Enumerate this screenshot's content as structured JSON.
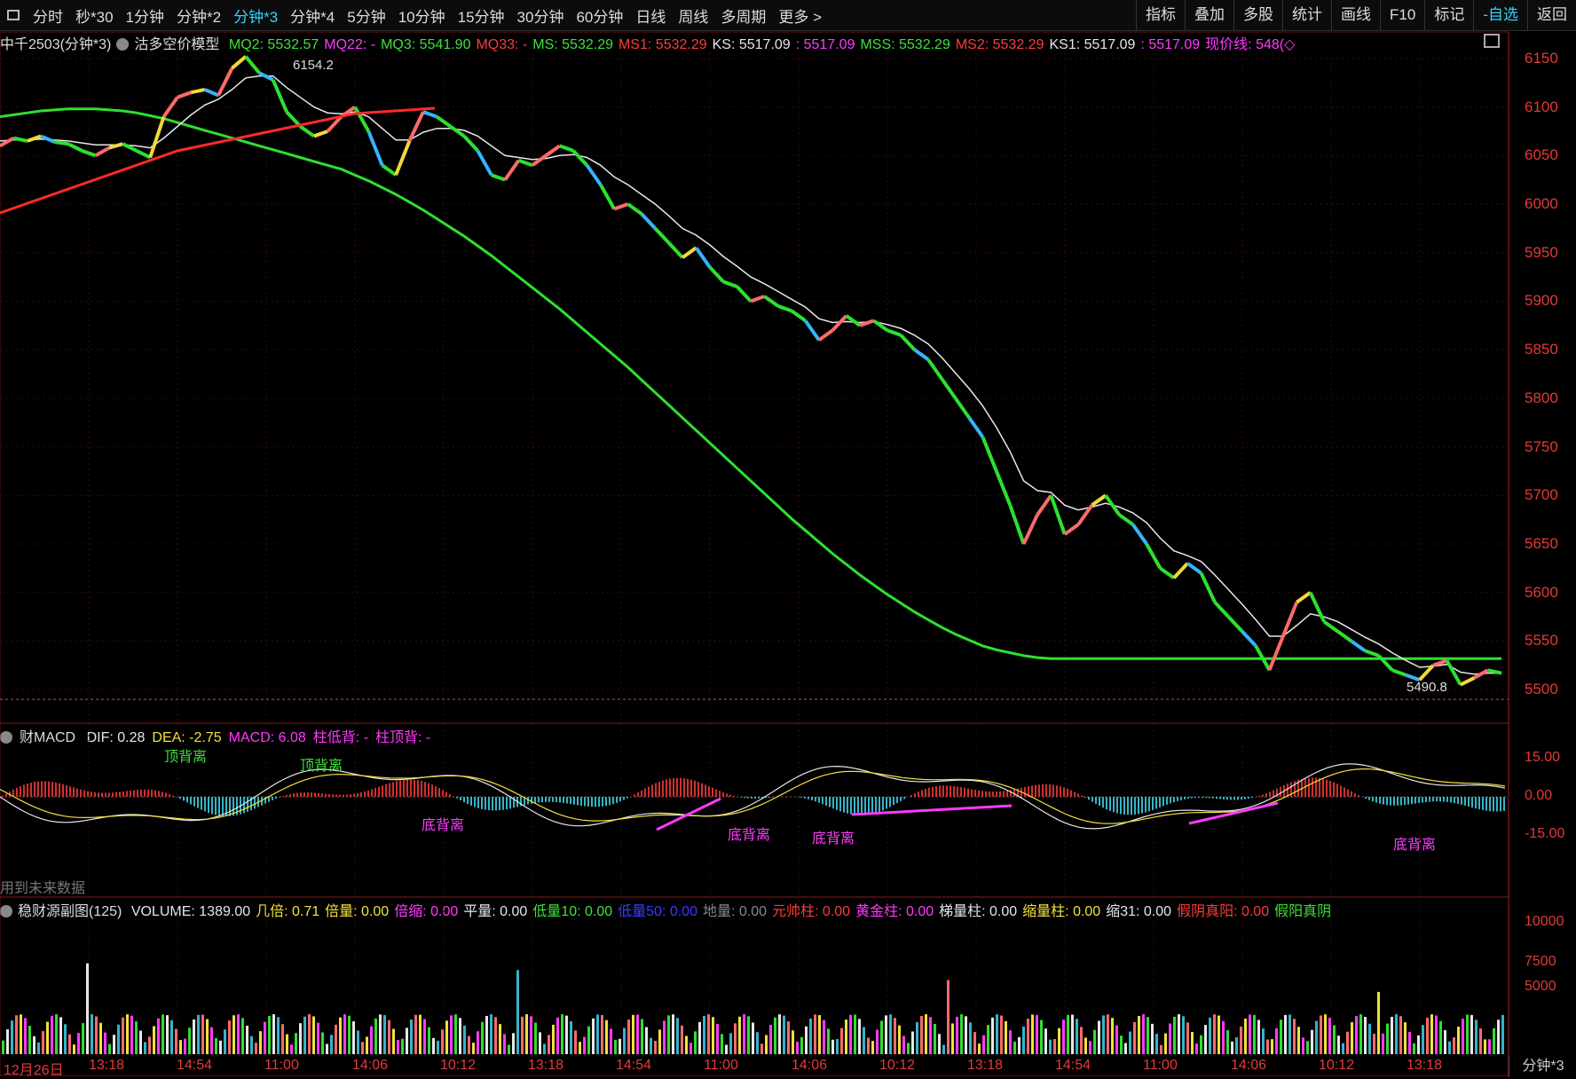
{
  "toolbar": {
    "periods": [
      "分时",
      "秒*30",
      "1分钟",
      "分钟*2",
      "分钟*3",
      "分钟*4",
      "5分钟",
      "10分钟",
      "15分钟",
      "30分钟",
      "60分钟",
      "日线",
      "周线",
      "多周期",
      "更多 >"
    ],
    "active_period": "分钟*3",
    "right_buttons": [
      "指标",
      "叠加",
      "多股",
      "统计",
      "画线",
      "F10",
      "标记",
      "-自选",
      "返回"
    ],
    "selected_right": "-自选"
  },
  "main_indicator": {
    "symbol": "中千2503(分钟*3)",
    "model": "沽多空价模型",
    "items": [
      {
        "label": "MQ2: 5532.57",
        "color": "#3ee03e"
      },
      {
        "label": "MQ22: -",
        "color": "#ff3aff"
      },
      {
        "label": "MQ3: 5541.90",
        "color": "#3ee03e"
      },
      {
        "label": "MQ33: -",
        "color": "#ff3b3b"
      },
      {
        "label": "MS: 5532.29",
        "color": "#3ee03e"
      },
      {
        "label": "MS1: 5532.29",
        "color": "#ff3b3b"
      },
      {
        "label": "KS: 5517.09",
        "color": "#e6e6e6"
      },
      {
        "label": ": 5517.09",
        "color": "#ff3aff"
      },
      {
        "label": "MSS: 5532.29",
        "color": "#3ee03e"
      },
      {
        "label": "MS2: 5532.29",
        "color": "#ff3b3b"
      },
      {
        "label": "KS1: 5517.09",
        "color": "#e6e6e6"
      },
      {
        "label": ": 5517.09",
        "color": "#ff3aff"
      },
      {
        "label": "现价线: 548(◇",
        "color": "#ff3aff"
      }
    ],
    "price_axis": [
      "6150",
      "6100",
      "6050",
      "6000",
      "5950",
      "5900",
      "5850",
      "5800",
      "5750",
      "5700",
      "5650",
      "5600",
      "5550",
      "5500"
    ],
    "high_label": "6154.2",
    "low_label": "5490.8"
  },
  "macd_panel": {
    "title": "财MACD",
    "items": [
      {
        "label": "DIF: 0.28",
        "color": "#e6e6e6"
      },
      {
        "label": "DEA: -2.75",
        "color": "#f2e23a"
      },
      {
        "label": "MACD: 6.08",
        "color": "#ff3aff"
      },
      {
        "label": "柱低背: -",
        "color": "#ff3aff"
      },
      {
        "label": "柱顶背: -",
        "color": "#ff3aff"
      }
    ],
    "axis": [
      "15.00",
      "0.00",
      "-15.00"
    ],
    "annotations": [
      "顶背离",
      "顶背离",
      "底背离",
      "底背离",
      "底背离",
      "底背离"
    ],
    "future_note": "用到未来数据"
  },
  "volume_panel": {
    "title": "稳财源副图(125)",
    "items": [
      {
        "label": "VOLUME: 1389.00",
        "color": "#e6e6e6"
      },
      {
        "label": "几倍: 0.71",
        "color": "#f2e23a"
      },
      {
        "label": "倍量: 0.00",
        "color": "#f2e23a"
      },
      {
        "label": "倍缩: 0.00",
        "color": "#ff3aff"
      },
      {
        "label": "平量: 0.00",
        "color": "#e6e6e6"
      },
      {
        "label": "低量10: 0.00",
        "color": "#3ee03e"
      },
      {
        "label": "低量50: 0.00",
        "color": "#3a3aff"
      },
      {
        "label": "地量: 0.00",
        "color": "#888888"
      },
      {
        "label": "元帅柱: 0.00",
        "color": "#ff3b3b"
      },
      {
        "label": "黄金柱: 0.00",
        "color": "#ff3aff"
      },
      {
        "label": "梯量柱: 0.00",
        "color": "#e6e6e6"
      },
      {
        "label": "缩量柱: 0.00",
        "color": "#f2e23a"
      },
      {
        "label": "缩31: 0.00",
        "color": "#e6e6e6"
      },
      {
        "label": "假阴真阳: 0.00",
        "color": "#ff3b3b"
      },
      {
        "label": "假阳真阴",
        "color": "#3ee03e"
      }
    ],
    "axis": [
      "10000",
      "7500",
      "5000"
    ]
  },
  "time_axis": [
    "12月26日",
    "13:18",
    "14:54",
    "11:00",
    "14:06",
    "10:12",
    "13:18",
    "14:54",
    "11:00",
    "14:06",
    "10:12",
    "13:18",
    "14:54",
    "11:00",
    "14:06",
    "10:12",
    "13:18"
  ],
  "timeframe_label": "分钟*3",
  "chart_data": {
    "type": "line",
    "title": "中千2503(分钟*3)",
    "ylim": [
      5470,
      6170
    ],
    "price": [
      6060,
      6068,
      6065,
      6070,
      6064,
      6062,
      6055,
      6050,
      6058,
      6062,
      6055,
      6048,
      6090,
      6110,
      6115,
      6118,
      6112,
      6140,
      6152,
      6135,
      6128,
      6095,
      6080,
      6070,
      6075,
      6090,
      6100,
      6075,
      6040,
      6030,
      6065,
      6095,
      6090,
      6080,
      6070,
      6055,
      6030,
      6025,
      6045,
      6040,
      6050,
      6060,
      6055,
      6040,
      6020,
      5995,
      6000,
      5990,
      5975,
      5960,
      5945,
      5955,
      5935,
      5920,
      5915,
      5900,
      5905,
      5895,
      5890,
      5880,
      5860,
      5870,
      5885,
      5875,
      5880,
      5870,
      5865,
      5850,
      5840,
      5820,
      5800,
      5780,
      5760,
      5725,
      5690,
      5650,
      5680,
      5700,
      5660,
      5670,
      5690,
      5700,
      5680,
      5670,
      5650,
      5625,
      5615,
      5630,
      5620,
      5590,
      5575,
      5560,
      5545,
      5520,
      5555,
      5590,
      5600,
      5570,
      5560,
      5550,
      5540,
      5535,
      5520,
      5515,
      5510,
      5525,
      5530,
      5505,
      5512,
      5520,
      5517
    ],
    "ma_fast": [
      6065,
      6066,
      6066,
      6067,
      6066,
      6065,
      6063,
      6061,
      6061,
      6061,
      6060,
      6058,
      6068,
      6080,
      6092,
      6102,
      6108,
      6118,
      6130,
      6132,
      6132,
      6120,
      6110,
      6100,
      6094,
      6093,
      6095,
      6090,
      6078,
      6066,
      6066,
      6074,
      6078,
      6078,
      6076,
      6070,
      6060,
      6050,
      6048,
      6046,
      6047,
      6050,
      6051,
      6048,
      6040,
      6028,
      6020,
      6010,
      6000,
      5988,
      5975,
      5968,
      5958,
      5946,
      5936,
      5925,
      5918,
      5910,
      5902,
      5894,
      5882,
      5878,
      5879,
      5878,
      5879,
      5876,
      5872,
      5865,
      5856,
      5842,
      5826,
      5810,
      5792,
      5770,
      5745,
      5715,
      5705,
      5703,
      5690,
      5685,
      5688,
      5692,
      5688,
      5682,
      5672,
      5656,
      5643,
      5638,
      5632,
      5618,
      5603,
      5588,
      5572,
      5555,
      5555,
      5566,
      5578,
      5575,
      5570,
      5562,
      5554,
      5547,
      5538,
      5530,
      5523,
      5524,
      5526,
      5518,
      5516,
      5517,
      5517
    ],
    "ma_slow_green": [
      6090,
      6092,
      6094,
      6096,
      6097,
      6098,
      6098,
      6098,
      6097,
      6096,
      6094,
      6091,
      6088,
      6084,
      6080,
      6076,
      6072,
      6068,
      6064,
      6060,
      6056,
      6052,
      6048,
      6044,
      6040,
      6036,
      6030,
      6024,
      6017,
      6010,
      6002,
      5994,
      5985,
      5976,
      5967,
      5957,
      5947,
      5936,
      5925,
      5914,
      5903,
      5892,
      5880,
      5868,
      5856,
      5844,
      5832,
      5819,
      5806,
      5793,
      5780,
      5767,
      5754,
      5741,
      5728,
      5715,
      5702,
      5689,
      5676,
      5664,
      5652,
      5640,
      5629,
      5618,
      5608,
      5598,
      5589,
      5580,
      5572,
      5564,
      5557,
      5551,
      5545,
      5541,
      5538,
      5535,
      5533,
      5532,
      5532,
      5532,
      5532,
      5532,
      5532,
      5532,
      5532,
      5532,
      5532,
      5532,
      5532,
      5532,
      5532,
      5532,
      5532,
      5532,
      5532,
      5532,
      5532,
      5532,
      5532,
      5532,
      5532,
      5532,
      5532,
      5532,
      5532,
      5532,
      5532,
      5532,
      5532,
      5532,
      5532
    ]
  }
}
